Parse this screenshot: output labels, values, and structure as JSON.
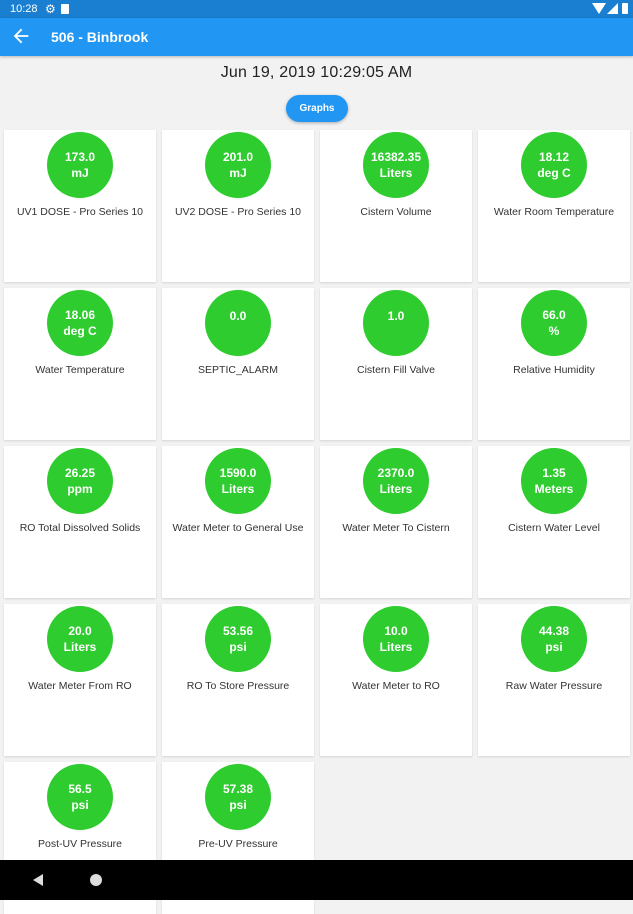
{
  "status_bar": {
    "time": "10:28"
  },
  "app_bar": {
    "title": "506 - Binbrook"
  },
  "datetime": "Jun 19, 2019 10:29:05 AM",
  "graphs_button": "Graphs",
  "colors": {
    "accent": "#2196f3",
    "ok_circle": "#2ecc2e"
  },
  "cards": [
    {
      "value": "173.0",
      "unit": "mJ",
      "label": "UV1 DOSE - Pro Series 10"
    },
    {
      "value": "201.0",
      "unit": "mJ",
      "label": "UV2 DOSE - Pro Series 10"
    },
    {
      "value": "16382.35",
      "unit": "Liters",
      "label": "Cistern Volume"
    },
    {
      "value": "18.12",
      "unit": "deg C",
      "label": "Water Room Temperature"
    },
    {
      "value": "18.06",
      "unit": "deg C",
      "label": "Water Temperature"
    },
    {
      "value": "0.0",
      "unit": "",
      "label": "SEPTIC_ALARM"
    },
    {
      "value": "1.0",
      "unit": "",
      "label": "Cistern Fill Valve"
    },
    {
      "value": "66.0",
      "unit": "%",
      "label": "Relative Humidity"
    },
    {
      "value": "26.25",
      "unit": "ppm",
      "label": "RO Total Dissolved Solids"
    },
    {
      "value": "1590.0",
      "unit": "Liters",
      "label": "Water Meter to General Use"
    },
    {
      "value": "2370.0",
      "unit": "Liters",
      "label": "Water Meter To Cistern"
    },
    {
      "value": "1.35",
      "unit": "Meters",
      "label": "Cistern Water Level"
    },
    {
      "value": "20.0",
      "unit": "Liters",
      "label": "Water Meter From RO"
    },
    {
      "value": "53.56",
      "unit": "psi",
      "label": "RO To Store Pressure"
    },
    {
      "value": "10.0",
      "unit": "Liters",
      "label": "Water Meter to RO"
    },
    {
      "value": "44.38",
      "unit": "psi",
      "label": "Raw Water Pressure"
    },
    {
      "value": "56.5",
      "unit": "psi",
      "label": "Post-UV Pressure"
    },
    {
      "value": "57.38",
      "unit": "psi",
      "label": "Pre-UV Pressure"
    }
  ]
}
